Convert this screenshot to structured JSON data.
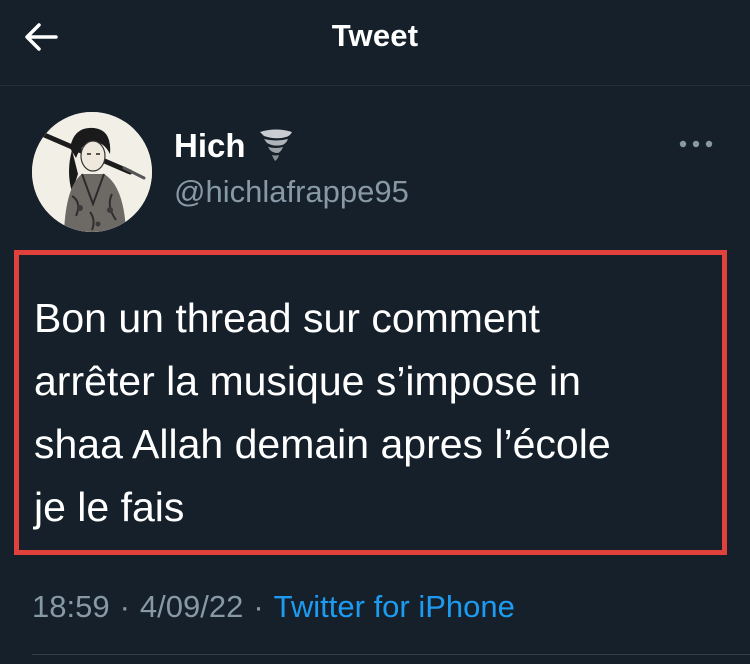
{
  "header": {
    "title": "Tweet",
    "back_icon": "arrow-left-icon"
  },
  "author": {
    "display_name": "Hich",
    "emoji_icon": "tornado-icon",
    "handle": "@hichlafrappe95",
    "avatar_icon": "samurai-avatar",
    "more_icon": "more-horizontal-icon"
  },
  "tweet": {
    "text": "Bon un thread sur comment\narrêter la musique s’impose in\nshaa Allah demain apres l’école\nje le fais",
    "highlight_color": "#e0413a"
  },
  "meta": {
    "time": "18:59",
    "separator": "·",
    "date": "4/09/22",
    "source": "Twitter for iPhone"
  },
  "colors": {
    "background": "#15202b",
    "text": "#ffffff",
    "muted": "#8899a6",
    "link": "#1d9bf0"
  }
}
